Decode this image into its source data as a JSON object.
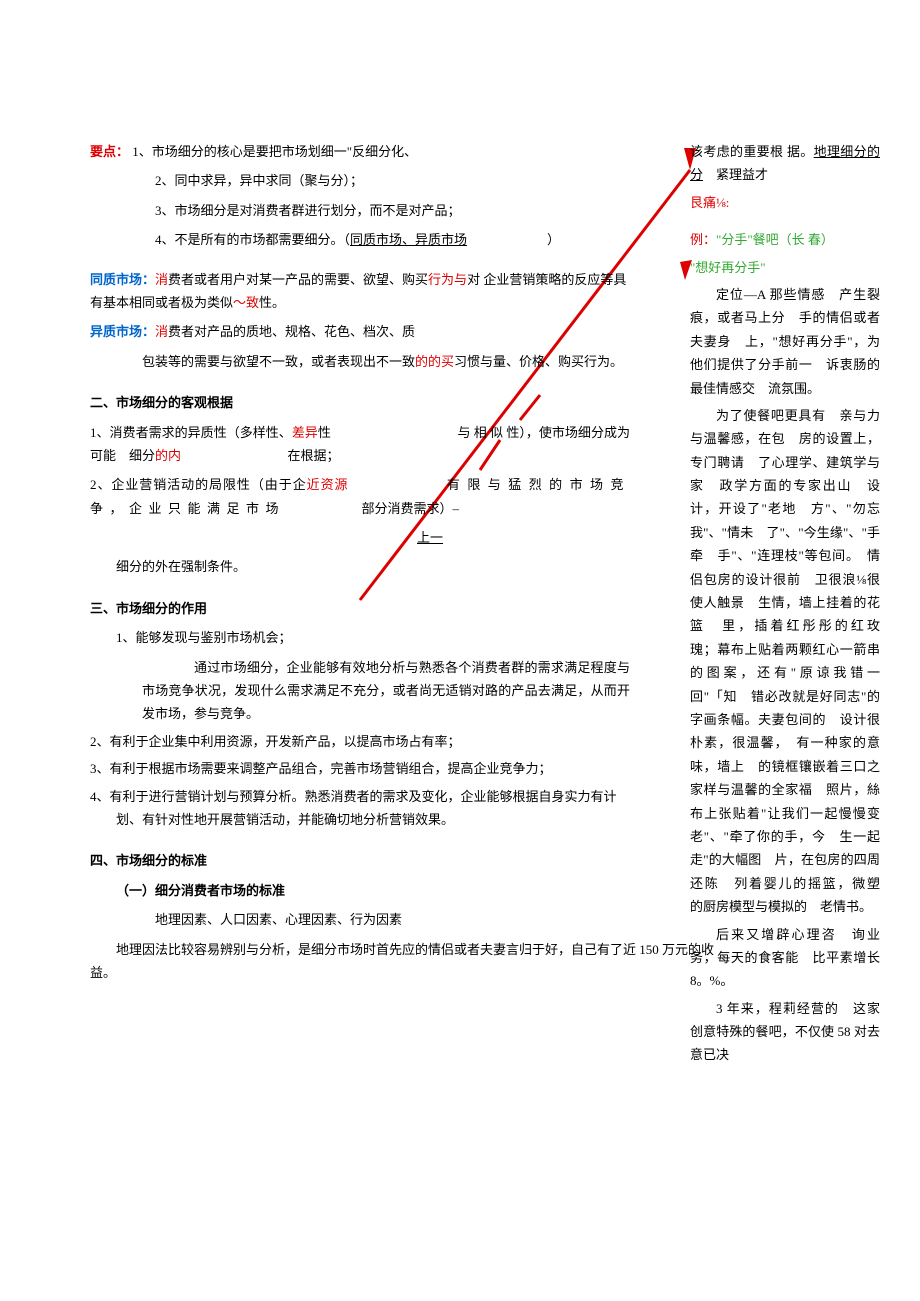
{
  "main": {
    "keypoints_label": "要点：",
    "kp1": "1、市场细分的核心是要把市场划细一\"反细分化、",
    "kp2": "2、同中求异，异中求同（聚与分）；",
    "kp3": "3、市场细分是对消费者群进行划分，而不是对产品；",
    "kp4_a": "4、不是所有的市场都需要细分。（",
    "kp4_u": "同质市场、异质市场",
    "kp4_b": "）",
    "tongzhi_label": "同质市场：",
    "tongzhi_a": "消",
    "tongzhi_b": "费者或者用户对某一产品的需要、欲望、购买",
    "tongzhi_c": "行为与",
    "tongzhi_d": "对 企业营销策略的反应等具有基本相同或者极为类似",
    "tongzhi_e": "～致",
    "tongzhi_f": "性。",
    "yizhi_label": "异质市场：",
    "yizhi_a": "消",
    "yizhi_b": "费者对产品的质地、规格、花色、档次、质",
    "yizhi_c": "包装等的需要与欲望不一致，或者表现出不一致",
    "yizhi_d": "的的买",
    "yizhi_e": "习惯与量、价格、购买行为。",
    "sec2_title": "二、市场细分的客观根据",
    "sec2_1a": "1、消费者需求的异质性（多样性、",
    "sec2_1b": "差异",
    "sec2_1c": "性",
    "sec2_1d": "与 相 似 性），使市场细分成为可能　细分",
    "sec2_1e": "的内",
    "sec2_1f": "在根据；",
    "sec2_2a": "2、企业营销活动的局限性（由于企",
    "sec2_2b": "近资源",
    "sec2_2c": "有限与猛烈的市场竞争，企业只能满足市场",
    "sec2_2d": "部分消费需求）–",
    "sec2_up": "上一",
    "sec2_3": "细分的外在强制条件。",
    "sec3_title": "三、市场细分的作用",
    "sec3_1": "1、能够发现与鉴别市场机会；",
    "sec3_1_body": "通过市场细分，企业能够有效地分析与熟悉各个消费者群的需求满足程度与市场竞争状况，发现什么需求满足不充分，或者尚无适销对路的产品去满足，从而开发市场，参与竞争。",
    "sec3_2": "2、有利于企业集中利用资源，开发新产品，以提高市场占有率；",
    "sec3_3": "3、有利于根据市场需要来调整产品组合，完善市场营销组合，提高企业竞争力；",
    "sec3_4": "4、有利于进行营销计划与预算分析。熟悉消费者的需求及变化，企业能够根据自身实力有计划、有针对性地开展营销活动，并能确切地分析营销效果。",
    "sec4_title": "四、市场细分的标准",
    "sec4_sub": "（一）细分消费者市场的标准",
    "sec4_items": "地理因素、人口因素、心理因素、行为因素",
    "sec4_body": "地理因法比较容易辨别与分析，是细分市场时首先应的情侣或者夫妻言归于好，自己有了近 150 万元的收益。"
  },
  "side": {
    "s0a": "该考虑的重要根 据。",
    "s0b": "地理细分的分",
    "s0c": "　紧理益才",
    "s0d": " 艮痛⅛:",
    "ex_label": "例：",
    "ex_title": "\"分手\"餐吧（长 春）",
    "ex_quote": "\"想好再分手\"",
    "p1": "定位—A 那些情感　产生裂痕，或者马上分　手的情侣或者夫妻身　上，\"想好再分手\"，为　他们提供了分手前一　诉衷肠的最佳情感交　流氛围。",
    "p2": "为了使餐吧更具有　亲与力与温馨感，在包　房的设置上，专门聘请　了心理学、建筑学与家　政学方面的专家出山　设计，开设了\"老地　方\"、\"勿忘我\"、\"情未　了\"、\"今生缘\"、\"手牵　手\"、\"连理枝\"等包间。　情侣包房的设计很前　卫很浪⅛很使人触景　生情，墙上挂着的花篮　里，插着红彤彤的红玫　瑰；幕布上贴着两颗红心一箭串的图案，还有\"原谅我错一回\"「知　错必改就是好同志\"的　字画条幅。夫妻包间的　设计很朴素，很温馨，　有一种家的意味，墙上　的镜框镶嵌着三口之　家样与温馨的全家福　照片，絲布上张贴着\"让我们一起慢慢变　老\"、\"牵了你的手，今　生一起走\"的大幅图　片，在包房的四周还陈　列着婴儿的摇篮，微塑　的厨房模型与模拟的　老情书。",
    "p3": "后来又增辟心理咨　询业务，每天的食客能　比平素增长 8。%。",
    "p4": "3 年来，程莉经营的　这家创意特殊的餐吧，不仅使 58 对去意已决"
  }
}
